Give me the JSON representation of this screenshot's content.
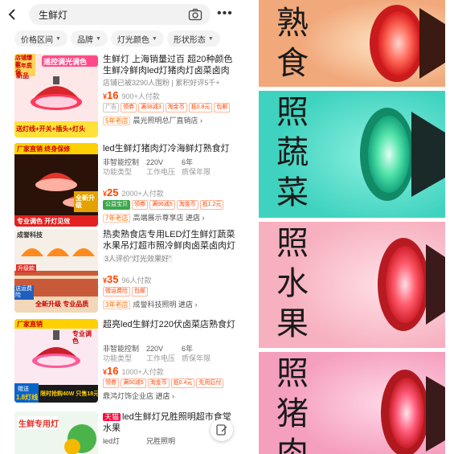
{
  "search": {
    "query": "生鲜灯"
  },
  "filters": [
    {
      "label": "价格区间"
    },
    {
      "label": "品牌"
    },
    {
      "label": "灯光颜色"
    },
    {
      "label": "形状形态"
    }
  ],
  "items": [
    {
      "thumb_text": [
        "遥控调光调色",
        "店铺爆款",
        "五年质保",
        "新品",
        "送灯线+开关+插头+灯头"
      ],
      "title": "生鲜灯 上海销量过百 超20种颜色生鲜冷鲜肉led灯猪肉灯卤菜卤肉",
      "sub": "店铺已被3290人围粉 | 累积好评5千+",
      "price": "16",
      "paid": "900+人付款",
      "tags": [
        "广告",
        "领券",
        "满38减3",
        "淘金币",
        "抵0.8元",
        "包邮"
      ],
      "shop_badge": "5年老店",
      "shop": "晨光照明总厂直销店"
    },
    {
      "thumb_text": [
        "厂家直销",
        "终身保修",
        "全新升级",
        "专业调色",
        "开灯见效"
      ],
      "title": "led生鲜灯猪肉灯冷海鲜灯熟食灯",
      "spec_rows": [
        [
          "非智能控制",
          "220V",
          "6年"
        ],
        [
          "功能类型",
          "工作电压",
          "质保年限"
        ]
      ],
      "price": "25",
      "paid": "2000+人付款",
      "tags": [
        "公益宝贝",
        "领券",
        "满96减5",
        "淘金币",
        "抵1.2元"
      ],
      "shop_badge": "7年老店",
      "shop": "高端展示尊享店"
    },
    {
      "thumb_text": [
        "成誉科技",
        "升级款",
        "送运费险",
        "全新升级 专业品质"
      ],
      "title": "热卖熟食店专用LED灯生鲜灯蔬菜水果吊灯超市照冷鲜肉卤菜卤肉灯",
      "review": "3人评价“灯光效果好”",
      "price": "35",
      "paid": "96人付款",
      "tags": [
        "赠运费险",
        "包邮"
      ],
      "shop_badge": "3年老店",
      "shop": "成誉科技照明"
    },
    {
      "thumb_text": [
        "厂家直销",
        "专业调色",
        "赠送",
        "限时抢购40W 只售18元",
        "1.8灯线"
      ],
      "title": "超亮led生鲜灯220伏卤菜店熟食灯",
      "spec_rows": [
        [
          "非智能控制",
          "220V",
          "6年"
        ],
        [
          "功能类型",
          "工作电压",
          "质保年限"
        ]
      ],
      "price": "16",
      "paid": "1000+人付款",
      "tags": [
        "领券",
        "满50减5",
        "淘金币",
        "抵0.4元",
        "先用后付"
      ],
      "shop": "鼎鸿灯饰企业店"
    },
    {
      "thumb_text": [
        "生鲜专用灯"
      ],
      "badge": "天猫",
      "title": "led生鲜灯兄胜照明超市食堂水果",
      "spec_rows": [
        [
          "led灯",
          "兄胜照明"
        ]
      ]
    }
  ],
  "go_label": "进店",
  "panels": [
    {
      "text": "熟食",
      "bg": "#f1a87b",
      "lamp": "#d81d1f"
    },
    {
      "text": "照蔬菜",
      "bg": "#3fd3bf",
      "lamp": "#16a37c"
    },
    {
      "text": "照水果",
      "bg": "#f7b0c0",
      "lamp": "#d0202b"
    },
    {
      "text": "照猪肉",
      "bg": "#f59fbf",
      "lamp": "#c81c24"
    }
  ],
  "colors": {
    "accent": "#ff4400",
    "brand_tmall": "#ff0036"
  }
}
